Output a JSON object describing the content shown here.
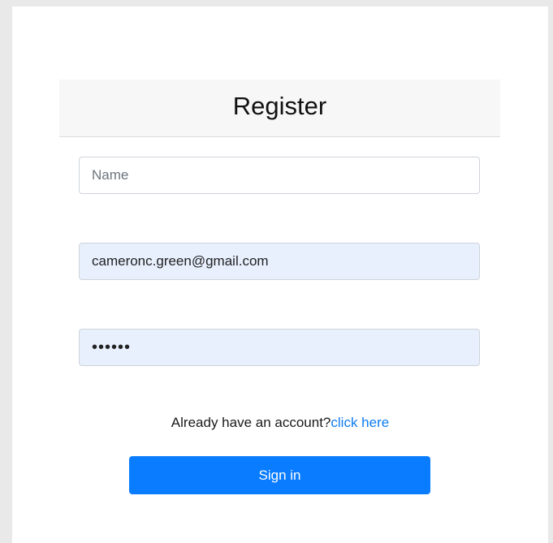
{
  "form": {
    "title": "Register",
    "name_placeholder": "Name",
    "name_value": "",
    "email_value": "cameronc.green@gmail.com",
    "password_value": "••••••",
    "account_prompt": "Already have an account?",
    "account_link": "click here",
    "submit_label": "Sign in"
  },
  "colors": {
    "header_background": "#f7f7f7",
    "autofill_background": "#e8f0fe",
    "link": "#0d7cf2",
    "button": "#0a7cff"
  }
}
